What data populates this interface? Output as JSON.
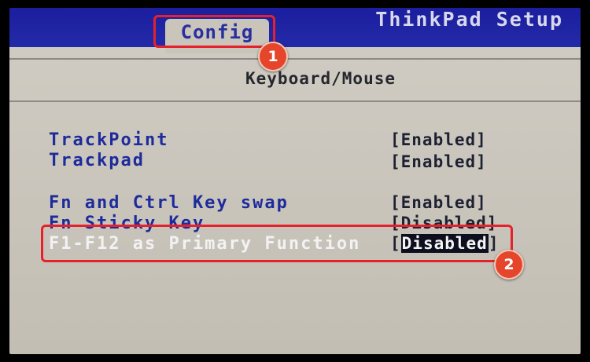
{
  "app_title": "ThinkPad Setup",
  "active_tab": "Config",
  "panel_title": "Keyboard/Mouse",
  "settings": [
    {
      "label": "TrackPoint",
      "value": "[Enabled]"
    },
    {
      "label": "Trackpad",
      "value": "[Enabled]"
    },
    {
      "label": "Fn and Ctrl Key swap",
      "value": "[Enabled]"
    },
    {
      "label": "Fn Sticky Key",
      "value": "[Disabled]"
    },
    {
      "label": "F1-F12 as Primary Function",
      "value_open": "[",
      "value_selected": "Disabled",
      "value_close": "]"
    }
  ],
  "annotations": {
    "badge_1": "1",
    "badge_2": "2",
    "color": "#e6212b"
  },
  "colors": {
    "header_blue": "#1b1e9e",
    "panel_gray": "#cfcbc2",
    "label_blue": "#1e2b9b"
  }
}
